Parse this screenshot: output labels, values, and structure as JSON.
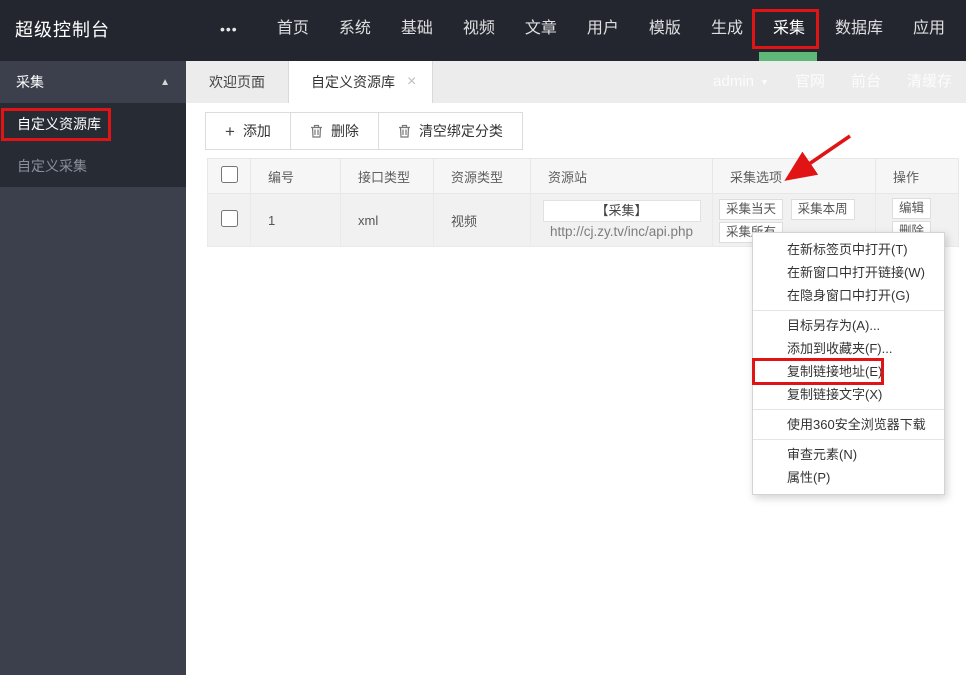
{
  "topbar": {
    "logo": "超级控制台",
    "nav": [
      "首页",
      "系统",
      "基础",
      "视频",
      "文章",
      "用户",
      "模版",
      "生成",
      "采集",
      "数据库",
      "应用"
    ],
    "active_nav": "采集"
  },
  "icons": {
    "more": "•••",
    "collapse": "▲",
    "close": "×",
    "caret": "▼",
    "add": "+"
  },
  "sidebar": {
    "group_title": "采集",
    "items": [
      {
        "label": "自定义资源库",
        "active": true
      },
      {
        "label": "自定义采集",
        "active": false
      }
    ]
  },
  "tabbar": {
    "tabs": [
      {
        "label": "欢迎页面",
        "active": false
      },
      {
        "label": "自定义资源库",
        "active": true
      }
    ],
    "user_menu": {
      "username": "admin",
      "links": [
        "官网",
        "前台",
        "清缓存"
      ]
    }
  },
  "toolbar": {
    "add_label": "添加",
    "delete_label": "删除",
    "clear_label": "清空绑定分类"
  },
  "table": {
    "headers": [
      "编号",
      "接口类型",
      "资源类型",
      "资源站",
      "采集选项",
      "操作"
    ],
    "rows": [
      {
        "id": "1",
        "api_type": "xml",
        "resource_type": "视频",
        "site_button": "【采集】",
        "site_url": "http://cj.zy.tv/inc/api.php",
        "collect_options": [
          "采集当天",
          "采集本周",
          "采集所有"
        ],
        "actions": [
          "编辑",
          "删除"
        ]
      }
    ]
  },
  "context_menu": {
    "groups": [
      [
        "在新标签页中打开(T)",
        "在新窗口中打开链接(W)",
        "在隐身窗口中打开(G)"
      ],
      [
        "目标另存为(A)...",
        "添加到收藏夹(F)...",
        "复制链接地址(E)",
        "复制链接文字(X)"
      ],
      [
        "使用360安全浏览器下载"
      ],
      [
        "审查元素(N)",
        "属性(P)"
      ]
    ],
    "highlighted_item": "复制链接地址(E)"
  },
  "colors": {
    "topbar_bg": "#23262e",
    "sidebar_bg": "#3b404c",
    "sidebar_panel_bg": "#272b34",
    "accent_green": "#5FB878",
    "annotation_red": "#e01414",
    "tabbar_bg": "#ececec"
  }
}
